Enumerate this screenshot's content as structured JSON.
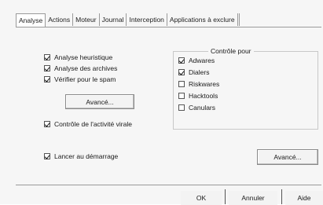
{
  "tabs": [
    "Analyse",
    "Actions",
    "Moteur",
    "Journal",
    "Interception",
    "Applications à exclure"
  ],
  "active_tab": "Analyse",
  "options": [
    {
      "label": "Analyse heuristique",
      "checked": true
    },
    {
      "label": "Analyse des archives",
      "checked": true
    },
    {
      "label": "Vérifier pour le spam",
      "checked": true
    }
  ],
  "advanced_button": "Avancé...",
  "viral_activity": {
    "label": "Contrôle de l'activité virale",
    "checked": true
  },
  "control_group": {
    "title": "Contrôle pour",
    "items": [
      {
        "label": "Adwares",
        "checked": true
      },
      {
        "label": "Dialers",
        "checked": true
      },
      {
        "label": "Riskwares",
        "checked": false
      },
      {
        "label": "Hacktools",
        "checked": false
      },
      {
        "label": "Canulars",
        "checked": false
      }
    ]
  },
  "startup": {
    "label": "Lancer au démarrage",
    "checked": true
  },
  "advanced_button_2": "Avancé...",
  "footer": {
    "ok": "OK",
    "cancel": "Annuler",
    "help": "Aide"
  }
}
